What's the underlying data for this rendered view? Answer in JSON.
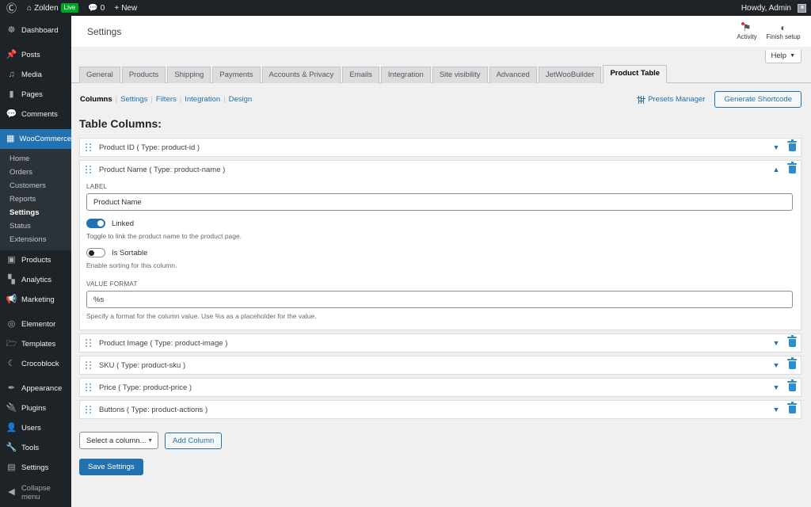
{
  "adminbar": {
    "wp_logo": "wordpress-logo-icon",
    "site_icon": "home-icon",
    "site_name": "Zolden",
    "live_badge": "Live",
    "comments_icon": "comment-bubble-icon",
    "comments_count": "0",
    "new_icon": "plus-icon",
    "new_label": "New",
    "howdy": "Howdy, Admin"
  },
  "sidebar": {
    "items": [
      {
        "label": "Dashboard",
        "icon": "dashboard-icon"
      },
      {
        "label": "Posts",
        "icon": "pin-icon"
      },
      {
        "label": "Media",
        "icon": "media-icon"
      },
      {
        "label": "Pages",
        "icon": "page-icon"
      },
      {
        "label": "Comments",
        "icon": "comment-icon"
      },
      {
        "label": "WooCommerce",
        "icon": "woocommerce-icon"
      },
      {
        "label": "Products",
        "icon": "products-icon"
      },
      {
        "label": "Analytics",
        "icon": "analytics-bars-icon"
      },
      {
        "label": "Marketing",
        "icon": "megaphone-icon"
      },
      {
        "label": "Elementor",
        "icon": "elementor-icon"
      },
      {
        "label": "Templates",
        "icon": "folder-icon"
      },
      {
        "label": "Crocoblock",
        "icon": "crocoblock-moon-icon"
      },
      {
        "label": "Appearance",
        "icon": "brush-icon"
      },
      {
        "label": "Plugins",
        "icon": "plug-icon"
      },
      {
        "label": "Users",
        "icon": "users-icon"
      },
      {
        "label": "Tools",
        "icon": "wrench-icon"
      },
      {
        "label": "Settings",
        "icon": "settings-sliders-icon"
      },
      {
        "label": "Collapse menu",
        "icon": "collapse-arrow-icon"
      }
    ],
    "woo_submenu": [
      {
        "label": "Home",
        "current": false
      },
      {
        "label": "Orders",
        "current": false
      },
      {
        "label": "Customers",
        "current": false
      },
      {
        "label": "Reports",
        "current": false
      },
      {
        "label": "Settings",
        "current": true
      },
      {
        "label": "Status",
        "current": false
      },
      {
        "label": "Extensions",
        "current": false
      }
    ]
  },
  "woo_header": {
    "title": "Settings",
    "activity_label": "Activity",
    "activity_icon": "flag-icon",
    "finish_setup_label": "Finish setup",
    "finish_setup_icon": "half-circle-icon"
  },
  "help": {
    "label": "Help",
    "caret": "caret-down-icon"
  },
  "nav_tabs": [
    {
      "label": "General",
      "active": false
    },
    {
      "label": "Products",
      "active": false
    },
    {
      "label": "Shipping",
      "active": false
    },
    {
      "label": "Payments",
      "active": false
    },
    {
      "label": "Accounts & Privacy",
      "active": false
    },
    {
      "label": "Emails",
      "active": false
    },
    {
      "label": "Integration",
      "active": false
    },
    {
      "label": "Site visibility",
      "active": false
    },
    {
      "label": "Advanced",
      "active": false
    },
    {
      "label": "JetWooBuilder",
      "active": false
    },
    {
      "label": "Product Table",
      "active": true
    }
  ],
  "subnav": [
    {
      "label": "Columns",
      "current": true
    },
    {
      "label": "Settings",
      "current": false
    },
    {
      "label": "Filters",
      "current": false
    },
    {
      "label": "Integration",
      "current": false
    },
    {
      "label": "Design",
      "current": false
    }
  ],
  "toolbar": {
    "presets_manager_label": "Presets Manager",
    "presets_manager_icon": "sliders-icon",
    "generate_shortcode_label": "Generate Shortcode"
  },
  "page": {
    "title": "Table Columns:"
  },
  "columns": [
    {
      "title": "Product ID ( Type: product-id )",
      "expanded": false,
      "chevron": "chevron-down-icon",
      "delete_icon": "trash-icon"
    },
    {
      "title": "Product Name ( Type: product-name )",
      "expanded": true,
      "chevron": "chevron-up-icon",
      "delete_icon": "trash-icon"
    },
    {
      "title": "Product Image ( Type: product-image )",
      "expanded": false,
      "chevron": "chevron-down-icon",
      "delete_icon": "trash-icon"
    },
    {
      "title": "SKU ( Type: product-sku )",
      "expanded": false,
      "chevron": "chevron-down-icon",
      "delete_icon": "trash-icon"
    },
    {
      "title": "Price ( Type: product-price )",
      "expanded": false,
      "chevron": "chevron-down-icon",
      "delete_icon": "trash-icon"
    },
    {
      "title": "Buttons ( Type: product-actions )",
      "expanded": false,
      "chevron": "chevron-down-icon",
      "delete_icon": "trash-icon"
    }
  ],
  "expanded_form": {
    "label_field_label": "LABEL",
    "label_field_value": "Product Name",
    "linked_toggle_label": "Linked",
    "linked_toggle_state": "on",
    "linked_help": "Toggle to link the product name to the product page.",
    "sortable_toggle_label": "Is Sortable",
    "sortable_toggle_state": "off",
    "sortable_help": "Enable sorting for this column.",
    "value_format_label": "VALUE FORMAT",
    "value_format_value": "%s",
    "value_format_help": "Specify a format for the column value. Use %s as a placeholder for the value."
  },
  "footer": {
    "select_placeholder": "Select a column...",
    "select_caret": "chevron-down-icon",
    "add_column_label": "Add Column",
    "save_settings_label": "Save Settings"
  },
  "colors": {
    "accent": "#2271b1",
    "admin_bg": "#1d2327",
    "submenu_bg": "#2c3338",
    "content_bg": "#f0f0f1",
    "live_green": "#00a32a",
    "notice_red": "#d63638",
    "trash_blue": "#2d8ccd"
  }
}
